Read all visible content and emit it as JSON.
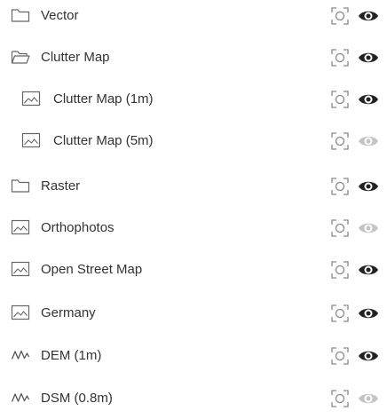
{
  "layers": [
    {
      "label": "Vector",
      "icon": "folder-icon",
      "visible": true
    },
    {
      "label": "Clutter Map",
      "icon": "folder-open-icon",
      "visible": true
    },
    {
      "label": "Clutter Map (1m)",
      "icon": "image-icon",
      "visible": true
    },
    {
      "label": "Clutter Map (5m)",
      "icon": "image-icon",
      "visible": false
    },
    {
      "label": "Raster",
      "icon": "folder-icon",
      "visible": true
    },
    {
      "label": "Orthophotos",
      "icon": "image-icon",
      "visible": false
    },
    {
      "label": "Open Street Map",
      "icon": "image-icon",
      "visible": true
    },
    {
      "label": "Germany",
      "icon": "image-icon",
      "visible": true
    },
    {
      "label": "DEM (1m)",
      "icon": "elevation-icon",
      "visible": true
    },
    {
      "label": "DSM (0.8m)",
      "icon": "elevation-icon",
      "visible": false
    }
  ],
  "colors": {
    "text": "#333333",
    "icon_stroke": "#666666",
    "eye_visible": "#222222",
    "eye_hidden": "#c4c4c4",
    "focus_icon": "#888888"
  }
}
